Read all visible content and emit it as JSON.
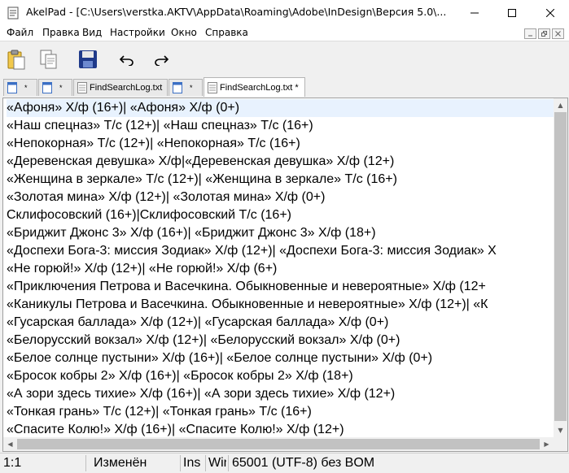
{
  "titlebar": {
    "title": "AkelPad - [C:\\Users\\verstka.AKTV\\AppData\\Roaming\\Adobe\\InDesign\\Версия 5.0\\...",
    "minimize_icon": "minimize-icon",
    "maximize_icon": "maximize-icon",
    "close_icon": "close-icon"
  },
  "menu": {
    "items": [
      "Файл",
      "Правка",
      "Вид",
      "Настройки",
      "Окно",
      "Справка"
    ]
  },
  "toolbar": {
    "buttons": [
      "paste-icon",
      "copy-icon",
      "save-icon",
      "undo-icon",
      "redo-icon"
    ]
  },
  "tabs": [
    {
      "label": "",
      "active": false
    },
    {
      "label": "",
      "active": false
    },
    {
      "label": "FindSearchLog.txt",
      "active": false
    },
    {
      "label": "",
      "active": false
    },
    {
      "label": "FindSearchLog.txt *",
      "active": true
    }
  ],
  "editor": {
    "lines": [
      " «Афоня» Х/ф (16+)| «Афоня» Х/ф (0+)",
      " «Наш спецназ» Т/с (12+)| «Наш спецназ» Т/с (16+)",
      " «Непокорная» Т/с (12+)| «Непокорная» Т/с (16+)",
      "«Деревенская девушка» Х/ф|«Деревенская девушка» Х/ф (12+)",
      " «Женщина в зеркале» Т/с (12+)| «Женщина в зеркале» Т/с (16+)",
      " «Золотая мина» Х/ф (12+)| «Золотая мина» Х/ф (0+)",
      "Склифосовский (16+)|Склифосовский Т/с (16+)",
      " «Бриджит Джонс 3» Х/ф (16+)| «Бриджит Джонс 3» Х/ф (18+)",
      " «Доспехи Бога-3: миссия Зодиак» Х/ф (12+)| «Доспехи Бога-3: миссия Зодиак» Х",
      " «Не горюй!» Х/ф (12+)| «Не горюй!» Х/ф (6+)",
      " «Приключения Петрова и Васечкина. Обыкновенные и невероятные» Х/ф (12+",
      " «Каникулы Петрова и Васечкина. Обыкновенные и невероятные» Х/ф (12+)| «К",
      " «Гусарская баллада» Х/ф (12+)| «Гусарская баллада» Х/ф (0+)",
      " «Белорусский вокзал» Х/ф (12+)| «Белорусский вокзал» Х/ф (0+)",
      " «Белое солнце пустыни» Х/ф (16+)| «Белое солнце пустыни» Х/ф (0+)",
      " «Бросок кобры 2» Х/ф (16+)| «Бросок кобры 2» Х/ф (18+)",
      " «А зори здесь тихие» Х/ф (16+)| «А зори здесь тихие» Х/ф (12+)",
      " «Тонкая грань» Т/с (12+)| «Тонкая грань» Т/с (16+)",
      " «Спасите Колю!» Х/ф (16+)| «Спасите Колю!» Х/ф (12+)"
    ]
  },
  "status": {
    "position": "1:1",
    "modified": "Изменён",
    "insert_mode": "Ins",
    "newline": "Win",
    "encoding": "65001 (UTF-8) без BOM"
  },
  "colors": {
    "current_line": "#e8f2fe",
    "save_icon": "#1f3a8a"
  }
}
